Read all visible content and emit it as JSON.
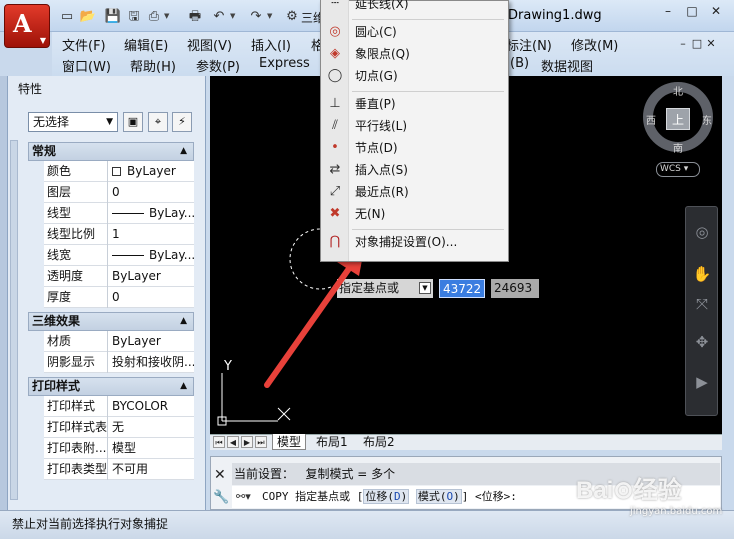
{
  "title_bar": {
    "doc_title": "Drawing1.dwg",
    "qa_workspace_text": "三维",
    "window_controls": [
      "–",
      "□",
      "✕"
    ]
  },
  "menu": {
    "row1": [
      "文件(F)",
      "编辑(E)",
      "视图(V)",
      "插入(I)",
      "格",
      "标注(N)",
      "修改(M)"
    ],
    "row2": [
      "窗口(W)",
      "帮助(H)",
      "参数(P)",
      "Express",
      "(B)",
      "数据视图"
    ],
    "doc_controls": [
      "–",
      "□",
      "✕"
    ]
  },
  "palette": {
    "title": "特性",
    "selection": "无选择",
    "sections": [
      {
        "name": "常规",
        "rows": [
          {
            "label": "颜色",
            "value": "ByLayer",
            "swatch": true
          },
          {
            "label": "图层",
            "value": "0"
          },
          {
            "label": "线型",
            "value": "ByLay...",
            "line": true
          },
          {
            "label": "线型比例",
            "value": "1"
          },
          {
            "label": "线宽",
            "value": "ByLay...",
            "line": true
          },
          {
            "label": "透明度",
            "value": "ByLayer"
          },
          {
            "label": "厚度",
            "value": "0"
          }
        ]
      },
      {
        "name": "三维效果",
        "rows": [
          {
            "label": "材质",
            "value": "ByLayer"
          },
          {
            "label": "阴影显示",
            "value": "投射和接收阴..."
          }
        ]
      },
      {
        "name": "打印样式",
        "rows": [
          {
            "label": "打印样式",
            "value": "BYCOLOR"
          },
          {
            "label": "打印样式表",
            "value": "无"
          },
          {
            "label": "打印表附...",
            "value": "模型"
          },
          {
            "label": "打印表类型",
            "value": "不可用"
          }
        ]
      }
    ]
  },
  "viewcube": {
    "north": "北",
    "south": "南",
    "east": "东",
    "west": "西",
    "top": "上",
    "wcs": "WCS"
  },
  "drawing": {
    "prompt_chip": "指定基点或",
    "coord_x": "43722",
    "coord_y": "24693",
    "ucs_y": "Y"
  },
  "layout_tabs": [
    "模型",
    "布局1",
    "布局2"
  ],
  "command_line": {
    "history": "当前设置：   复制模式 = 多个",
    "cmd_name": "COPY",
    "cmd_prompt": "指定基点或",
    "opt1_label": "位移",
    "opt1_key": "D",
    "opt2_label": "模式",
    "opt2_key": "O",
    "default": "<位移>:"
  },
  "status_text": "禁止对当前选择执行对象捕捉",
  "osnap_menu": [
    {
      "label": "延长线(X)",
      "icon": "extension-icon"
    },
    {
      "sep": true
    },
    {
      "label": "圆心(C)",
      "icon": "center-icon"
    },
    {
      "label": "象限点(Q)",
      "icon": "quadrant-icon"
    },
    {
      "label": "切点(G)",
      "icon": "tangent-icon"
    },
    {
      "sep": true
    },
    {
      "label": "垂直(P)",
      "icon": "perpendicular-icon"
    },
    {
      "label": "平行线(L)",
      "icon": "parallel-icon"
    },
    {
      "label": "节点(D)",
      "icon": "node-icon"
    },
    {
      "label": "插入点(S)",
      "icon": "insertion-icon"
    },
    {
      "label": "最近点(R)",
      "icon": "nearest-icon"
    },
    {
      "label": "无(N)",
      "icon": "none-icon"
    },
    {
      "sep": true
    },
    {
      "label": "对象捕捉设置(O)...",
      "icon": "osnap-settings-icon"
    }
  ],
  "watermark": {
    "logo": "Bai⊙经验",
    "url": "jingyan.baidu.com"
  },
  "colors": {
    "accent": "#3a7de0",
    "arrow": "#e8413a",
    "drawing_bg": "#000000",
    "logo_red": "#c7261a"
  }
}
